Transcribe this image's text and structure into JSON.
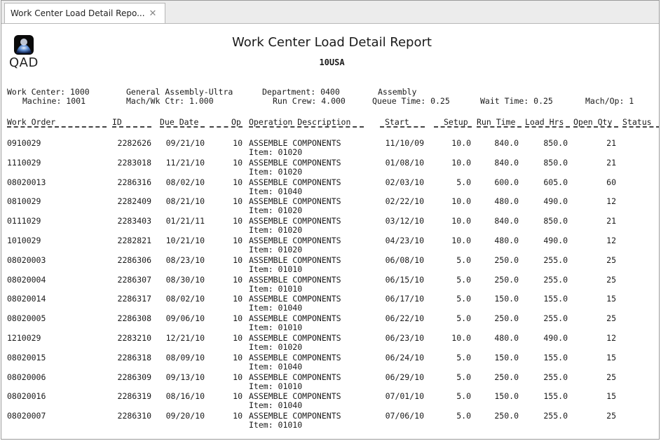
{
  "window": {
    "tab_title": "Work Center Load Detail Repo...",
    "tab_close": "✕"
  },
  "logo": {
    "text": "QAD",
    "icon": "qad-logo-icon"
  },
  "report": {
    "title": "Work Center Load Detail Report",
    "subtitle": "10USA"
  },
  "header_info": {
    "work_center": "Work Center: 1000",
    "machine": "Machine: 1001",
    "wc_desc": "General Assembly-Ultra",
    "mach_wk_ctr": "Mach/Wk Ctr: 1.000",
    "department": "Department: 0400",
    "run_crew": "Run Crew: 4.000",
    "dept_desc": "Assembly",
    "queue_time": "Queue Time: 0.25",
    "wait_time": "Wait Time: 0.25",
    "mach_op": "Mach/Op: 1"
  },
  "columns": {
    "work_order": "Work Order",
    "id": "ID",
    "due_date": "Due Date",
    "op": "Op",
    "operation_description": "Operation Description",
    "start": "Start",
    "setup": "Setup",
    "run_time": "Run Time",
    "load_hrs": "Load Hrs",
    "open_qty": "Open Qty",
    "status": "Status"
  },
  "rows": [
    {
      "wo": "0910029",
      "id": "2282626",
      "due": "09/21/10",
      "op": "10",
      "desc": "ASSEMBLE COMPONENTS",
      "item": "Item: 01020",
      "start": "11/10/09",
      "setup": "10.0",
      "run": "840.0",
      "load": "850.0",
      "qty": "21"
    },
    {
      "wo": "1110029",
      "id": "2283018",
      "due": "11/21/10",
      "op": "10",
      "desc": "ASSEMBLE COMPONENTS",
      "item": "Item: 01020",
      "start": "01/08/10",
      "setup": "10.0",
      "run": "840.0",
      "load": "850.0",
      "qty": "21"
    },
    {
      "wo": "08020013",
      "id": "2286316",
      "due": "08/02/10",
      "op": "10",
      "desc": "ASSEMBLE COMPONENTS",
      "item": "Item: 01040",
      "start": "02/03/10",
      "setup": "5.0",
      "run": "600.0",
      "load": "605.0",
      "qty": "60"
    },
    {
      "wo": "0810029",
      "id": "2282409",
      "due": "08/21/10",
      "op": "10",
      "desc": "ASSEMBLE COMPONENTS",
      "item": "Item: 01020",
      "start": "02/22/10",
      "setup": "10.0",
      "run": "480.0",
      "load": "490.0",
      "qty": "12"
    },
    {
      "wo": "0111029",
      "id": "2283403",
      "due": "01/21/11",
      "op": "10",
      "desc": "ASSEMBLE COMPONENTS",
      "item": "Item: 01020",
      "start": "03/12/10",
      "setup": "10.0",
      "run": "840.0",
      "load": "850.0",
      "qty": "21"
    },
    {
      "wo": "1010029",
      "id": "2282821",
      "due": "10/21/10",
      "op": "10",
      "desc": "ASSEMBLE COMPONENTS",
      "item": "Item: 01020",
      "start": "04/23/10",
      "setup": "10.0",
      "run": "480.0",
      "load": "490.0",
      "qty": "12"
    },
    {
      "wo": "08020003",
      "id": "2286306",
      "due": "08/23/10",
      "op": "10",
      "desc": "ASSEMBLE COMPONENTS",
      "item": "Item: 01010",
      "start": "06/08/10",
      "setup": "5.0",
      "run": "250.0",
      "load": "255.0",
      "qty": "25"
    },
    {
      "wo": "08020004",
      "id": "2286307",
      "due": "08/30/10",
      "op": "10",
      "desc": "ASSEMBLE COMPONENTS",
      "item": "Item: 01010",
      "start": "06/15/10",
      "setup": "5.0",
      "run": "250.0",
      "load": "255.0",
      "qty": "25"
    },
    {
      "wo": "08020014",
      "id": "2286317",
      "due": "08/02/10",
      "op": "10",
      "desc": "ASSEMBLE COMPONENTS",
      "item": "Item: 01040",
      "start": "06/17/10",
      "setup": "5.0",
      "run": "150.0",
      "load": "155.0",
      "qty": "15"
    },
    {
      "wo": "08020005",
      "id": "2286308",
      "due": "09/06/10",
      "op": "10",
      "desc": "ASSEMBLE COMPONENTS",
      "item": "Item: 01010",
      "start": "06/22/10",
      "setup": "5.0",
      "run": "250.0",
      "load": "255.0",
      "qty": "25"
    },
    {
      "wo": "1210029",
      "id": "2283210",
      "due": "12/21/10",
      "op": "10",
      "desc": "ASSEMBLE COMPONENTS",
      "item": "Item: 01020",
      "start": "06/23/10",
      "setup": "10.0",
      "run": "480.0",
      "load": "490.0",
      "qty": "12"
    },
    {
      "wo": "08020015",
      "id": "2286318",
      "due": "08/09/10",
      "op": "10",
      "desc": "ASSEMBLE COMPONENTS",
      "item": "Item: 01040",
      "start": "06/24/10",
      "setup": "5.0",
      "run": "150.0",
      "load": "155.0",
      "qty": "15"
    },
    {
      "wo": "08020006",
      "id": "2286309",
      "due": "09/13/10",
      "op": "10",
      "desc": "ASSEMBLE COMPONENTS",
      "item": "Item: 01010",
      "start": "06/29/10",
      "setup": "5.0",
      "run": "250.0",
      "load": "255.0",
      "qty": "25"
    },
    {
      "wo": "08020016",
      "id": "2286319",
      "due": "08/16/10",
      "op": "10",
      "desc": "ASSEMBLE COMPONENTS",
      "item": "Item: 01040",
      "start": "07/01/10",
      "setup": "5.0",
      "run": "150.0",
      "load": "155.0",
      "qty": "15"
    },
    {
      "wo": "08020007",
      "id": "2286310",
      "due": "09/20/10",
      "op": "10",
      "desc": "ASSEMBLE COMPONENTS",
      "item": "Item: 01010",
      "start": "07/06/10",
      "setup": "5.0",
      "run": "250.0",
      "load": "255.0",
      "qty": "25"
    }
  ]
}
